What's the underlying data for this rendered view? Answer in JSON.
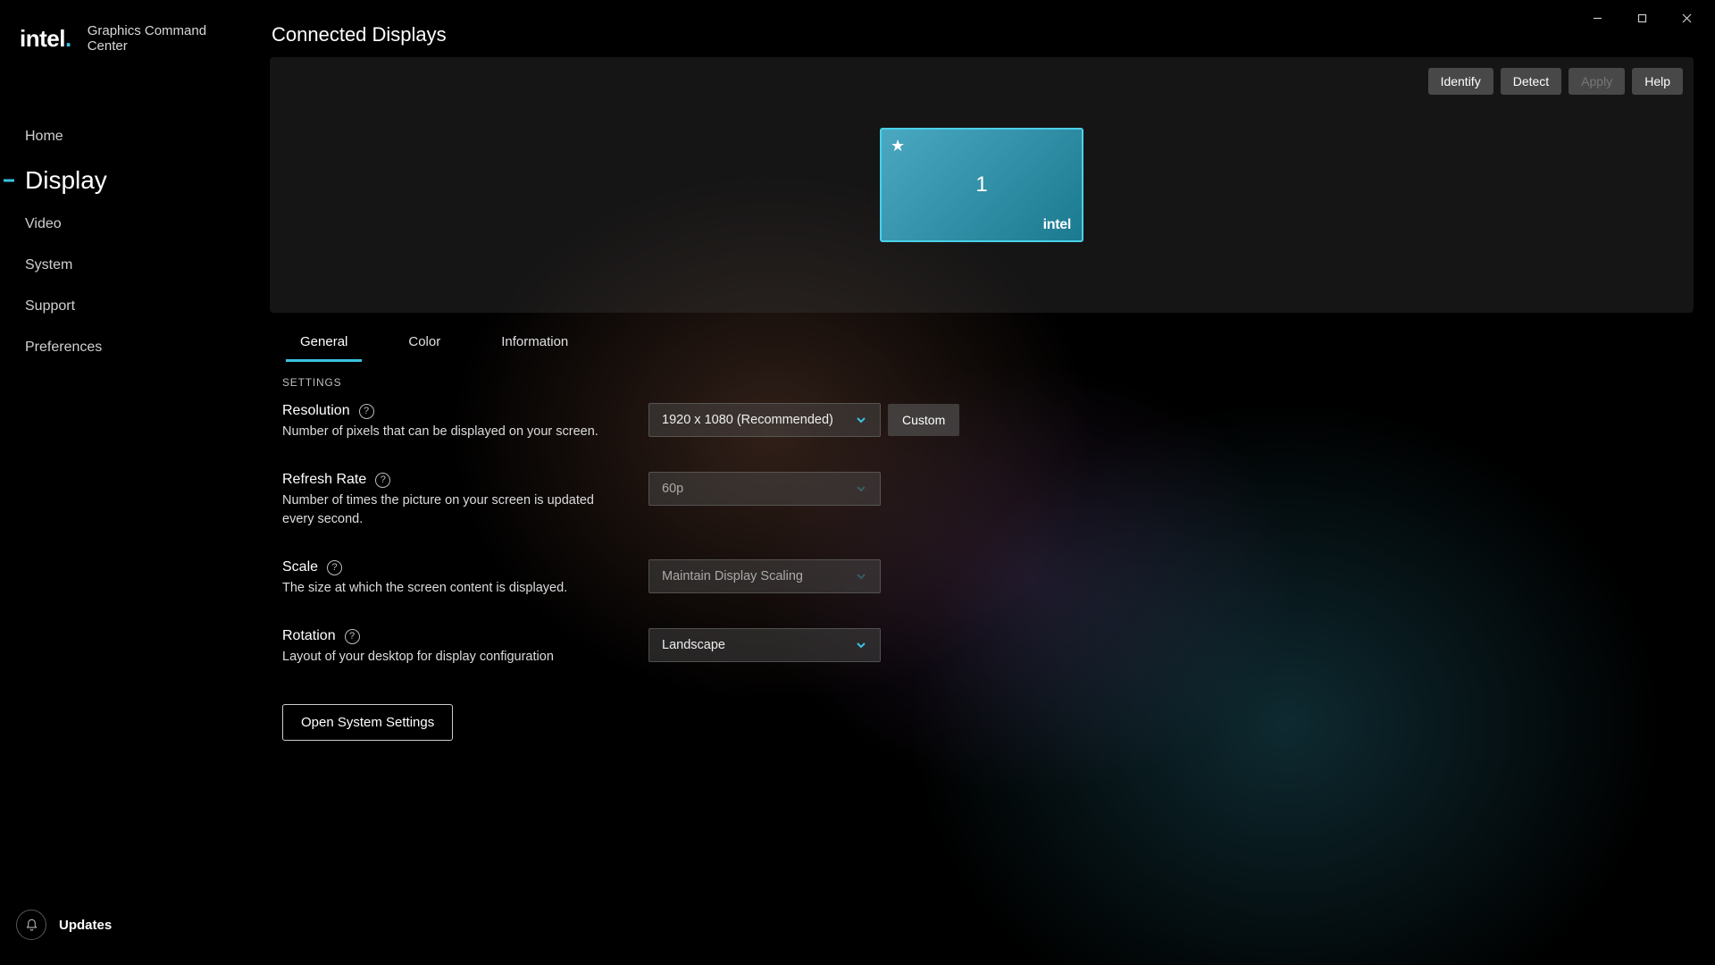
{
  "brand": {
    "logo": "intel",
    "sub": "Graphics Command Center"
  },
  "sidebar": {
    "items": [
      {
        "label": "Home"
      },
      {
        "label": "Display"
      },
      {
        "label": "Video"
      },
      {
        "label": "System"
      },
      {
        "label": "Support"
      },
      {
        "label": "Preferences"
      }
    ],
    "updates_label": "Updates"
  },
  "page_title": "Connected Displays",
  "panel_actions": {
    "identify": "Identify",
    "detect": "Detect",
    "apply": "Apply",
    "help": "Help"
  },
  "display_card": {
    "number": "1",
    "brand": "intel"
  },
  "tabs": [
    {
      "label": "General"
    },
    {
      "label": "Color"
    },
    {
      "label": "Information"
    }
  ],
  "settings_heading": "SETTINGS",
  "settings": {
    "resolution": {
      "label": "Resolution",
      "desc": "Number of pixels that can be displayed on your screen.",
      "value": "1920 x 1080 (Recommended)",
      "custom": "Custom"
    },
    "refresh": {
      "label": "Refresh Rate",
      "desc": "Number of times the picture on your screen is updated every second.",
      "value": "60p"
    },
    "scale": {
      "label": "Scale",
      "desc": "The size at which the screen content is displayed.",
      "value": "Maintain Display Scaling"
    },
    "rotation": {
      "label": "Rotation",
      "desc": "Layout of your desktop for display configuration",
      "value": "Landscape"
    }
  },
  "system_settings_btn": "Open System Settings"
}
